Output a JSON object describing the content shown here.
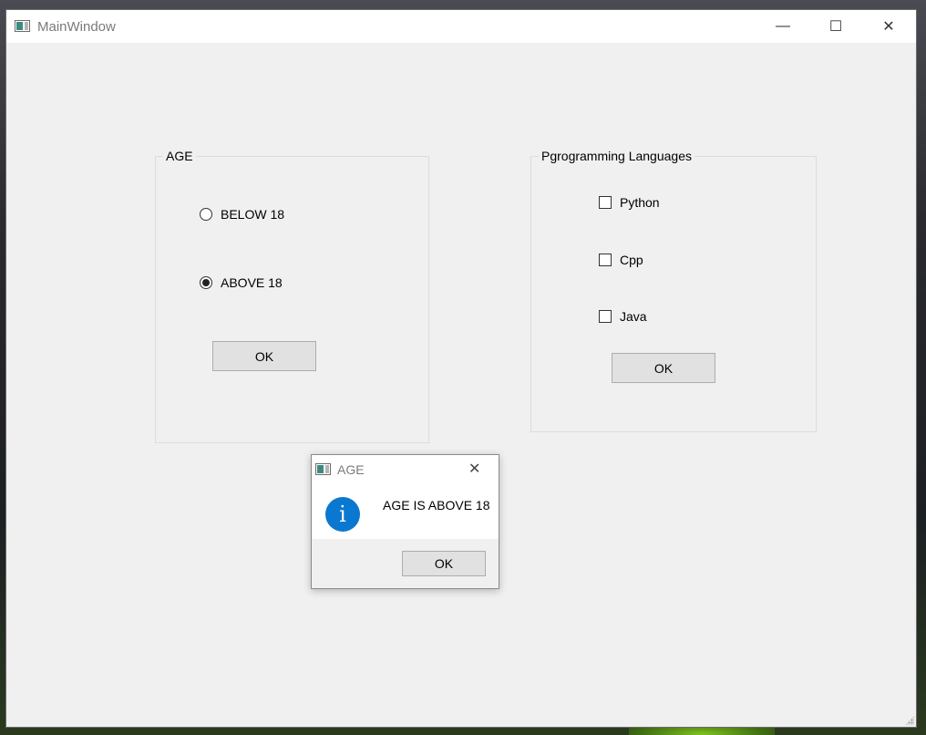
{
  "window": {
    "title": "MainWindow",
    "minimize_glyph": "—",
    "maximize_glyph": "☐",
    "close_glyph": "✕"
  },
  "age_group": {
    "title": "AGE",
    "options": [
      {
        "label": "BELOW 18",
        "checked": false
      },
      {
        "label": "ABOVE 18",
        "checked": true
      }
    ],
    "ok_label": "OK"
  },
  "languages_group": {
    "title": "Pgrogramming Languages",
    "options": [
      {
        "label": "Python",
        "checked": false
      },
      {
        "label": "Cpp",
        "checked": false
      },
      {
        "label": "Java",
        "checked": false
      }
    ],
    "ok_label": "OK"
  },
  "dialog": {
    "title": "AGE",
    "close_glyph": "✕",
    "icon_glyph": "i",
    "message": "AGE IS ABOVE 18",
    "ok_label": "OK"
  },
  "colors": {
    "info_icon": "#0a78d0",
    "window_bg": "#f0f0f0"
  }
}
